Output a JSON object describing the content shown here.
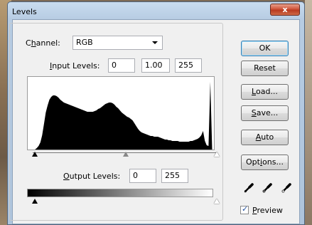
{
  "window": {
    "title": "Levels",
    "close_label": "x"
  },
  "channel": {
    "label_pre": "C",
    "label_mn": "h",
    "label_post": "annel:",
    "value": "RGB"
  },
  "input_levels": {
    "label_mn": "I",
    "label_post": "nput Levels:",
    "black": "0",
    "gamma": "1.00",
    "white": "255"
  },
  "output_levels": {
    "label_mn": "O",
    "label_post": "utput Levels:",
    "black": "0",
    "white": "255"
  },
  "buttons": {
    "ok": "OK",
    "reset": "Reset",
    "load_mn": "L",
    "load_post": "oad...",
    "save_mn": "S",
    "save_post": "ave...",
    "auto_mn": "A",
    "auto_post": "uto",
    "options_pre": "Opt",
    "options_mn": "i",
    "options_post": "ons..."
  },
  "preview": {
    "label_mn": "P",
    "label_post": "review",
    "checked": true,
    "check_mark": "✓"
  },
  "icons": [
    "black-point-eyedropper-icon",
    "gray-point-eyedropper-icon",
    "white-point-eyedropper-icon"
  ],
  "histogram": {
    "type": "area",
    "bins": [
      0,
      0,
      0,
      0,
      0,
      2,
      5,
      10,
      20,
      36,
      52,
      62,
      70,
      74,
      76,
      76,
      75,
      73,
      70,
      68,
      66,
      65,
      64,
      63,
      62,
      61,
      60,
      59,
      58,
      57,
      56,
      55,
      54,
      53,
      53,
      53,
      53,
      54,
      55,
      57,
      58,
      60,
      62,
      64,
      65,
      66,
      66,
      65,
      63,
      60,
      58,
      55,
      52,
      50,
      48,
      46,
      45,
      43,
      41,
      37,
      33,
      29,
      26,
      24,
      23,
      22,
      21,
      20,
      19,
      19,
      18,
      18,
      18,
      17,
      16,
      15,
      14,
      14,
      13,
      13,
      12,
      12,
      12,
      12,
      11,
      11,
      11,
      11,
      11,
      11,
      12,
      12,
      13,
      14,
      15,
      17,
      20,
      26,
      12,
      6,
      5,
      95,
      0,
      0
    ],
    "max": 100,
    "color": "#000000"
  }
}
